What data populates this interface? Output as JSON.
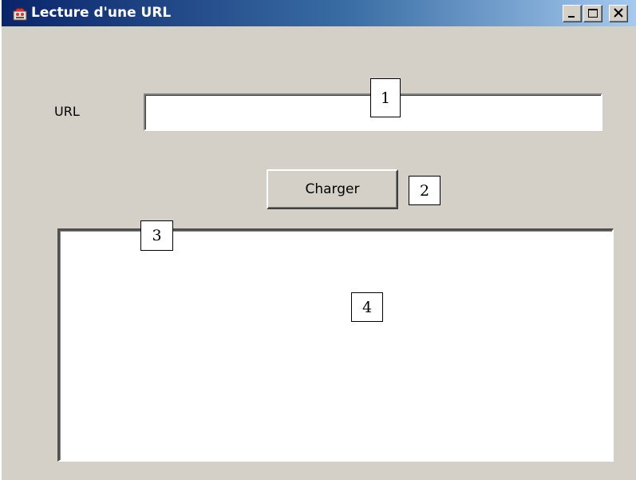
{
  "window": {
    "title": "Lecture d'une URL",
    "controls": {
      "minimize": "minimize-icon",
      "maximize": "maximize-icon",
      "close": "close-icon"
    },
    "colors": {
      "titlebar_start": "#0a246a",
      "titlebar_end": "#a6caf0",
      "face": "#d4d0c8"
    }
  },
  "form": {
    "url_label": "URL",
    "url_value": "",
    "load_button_label": "Charger",
    "output_text": ""
  },
  "callouts": [
    "1",
    "2",
    "3",
    "4"
  ]
}
